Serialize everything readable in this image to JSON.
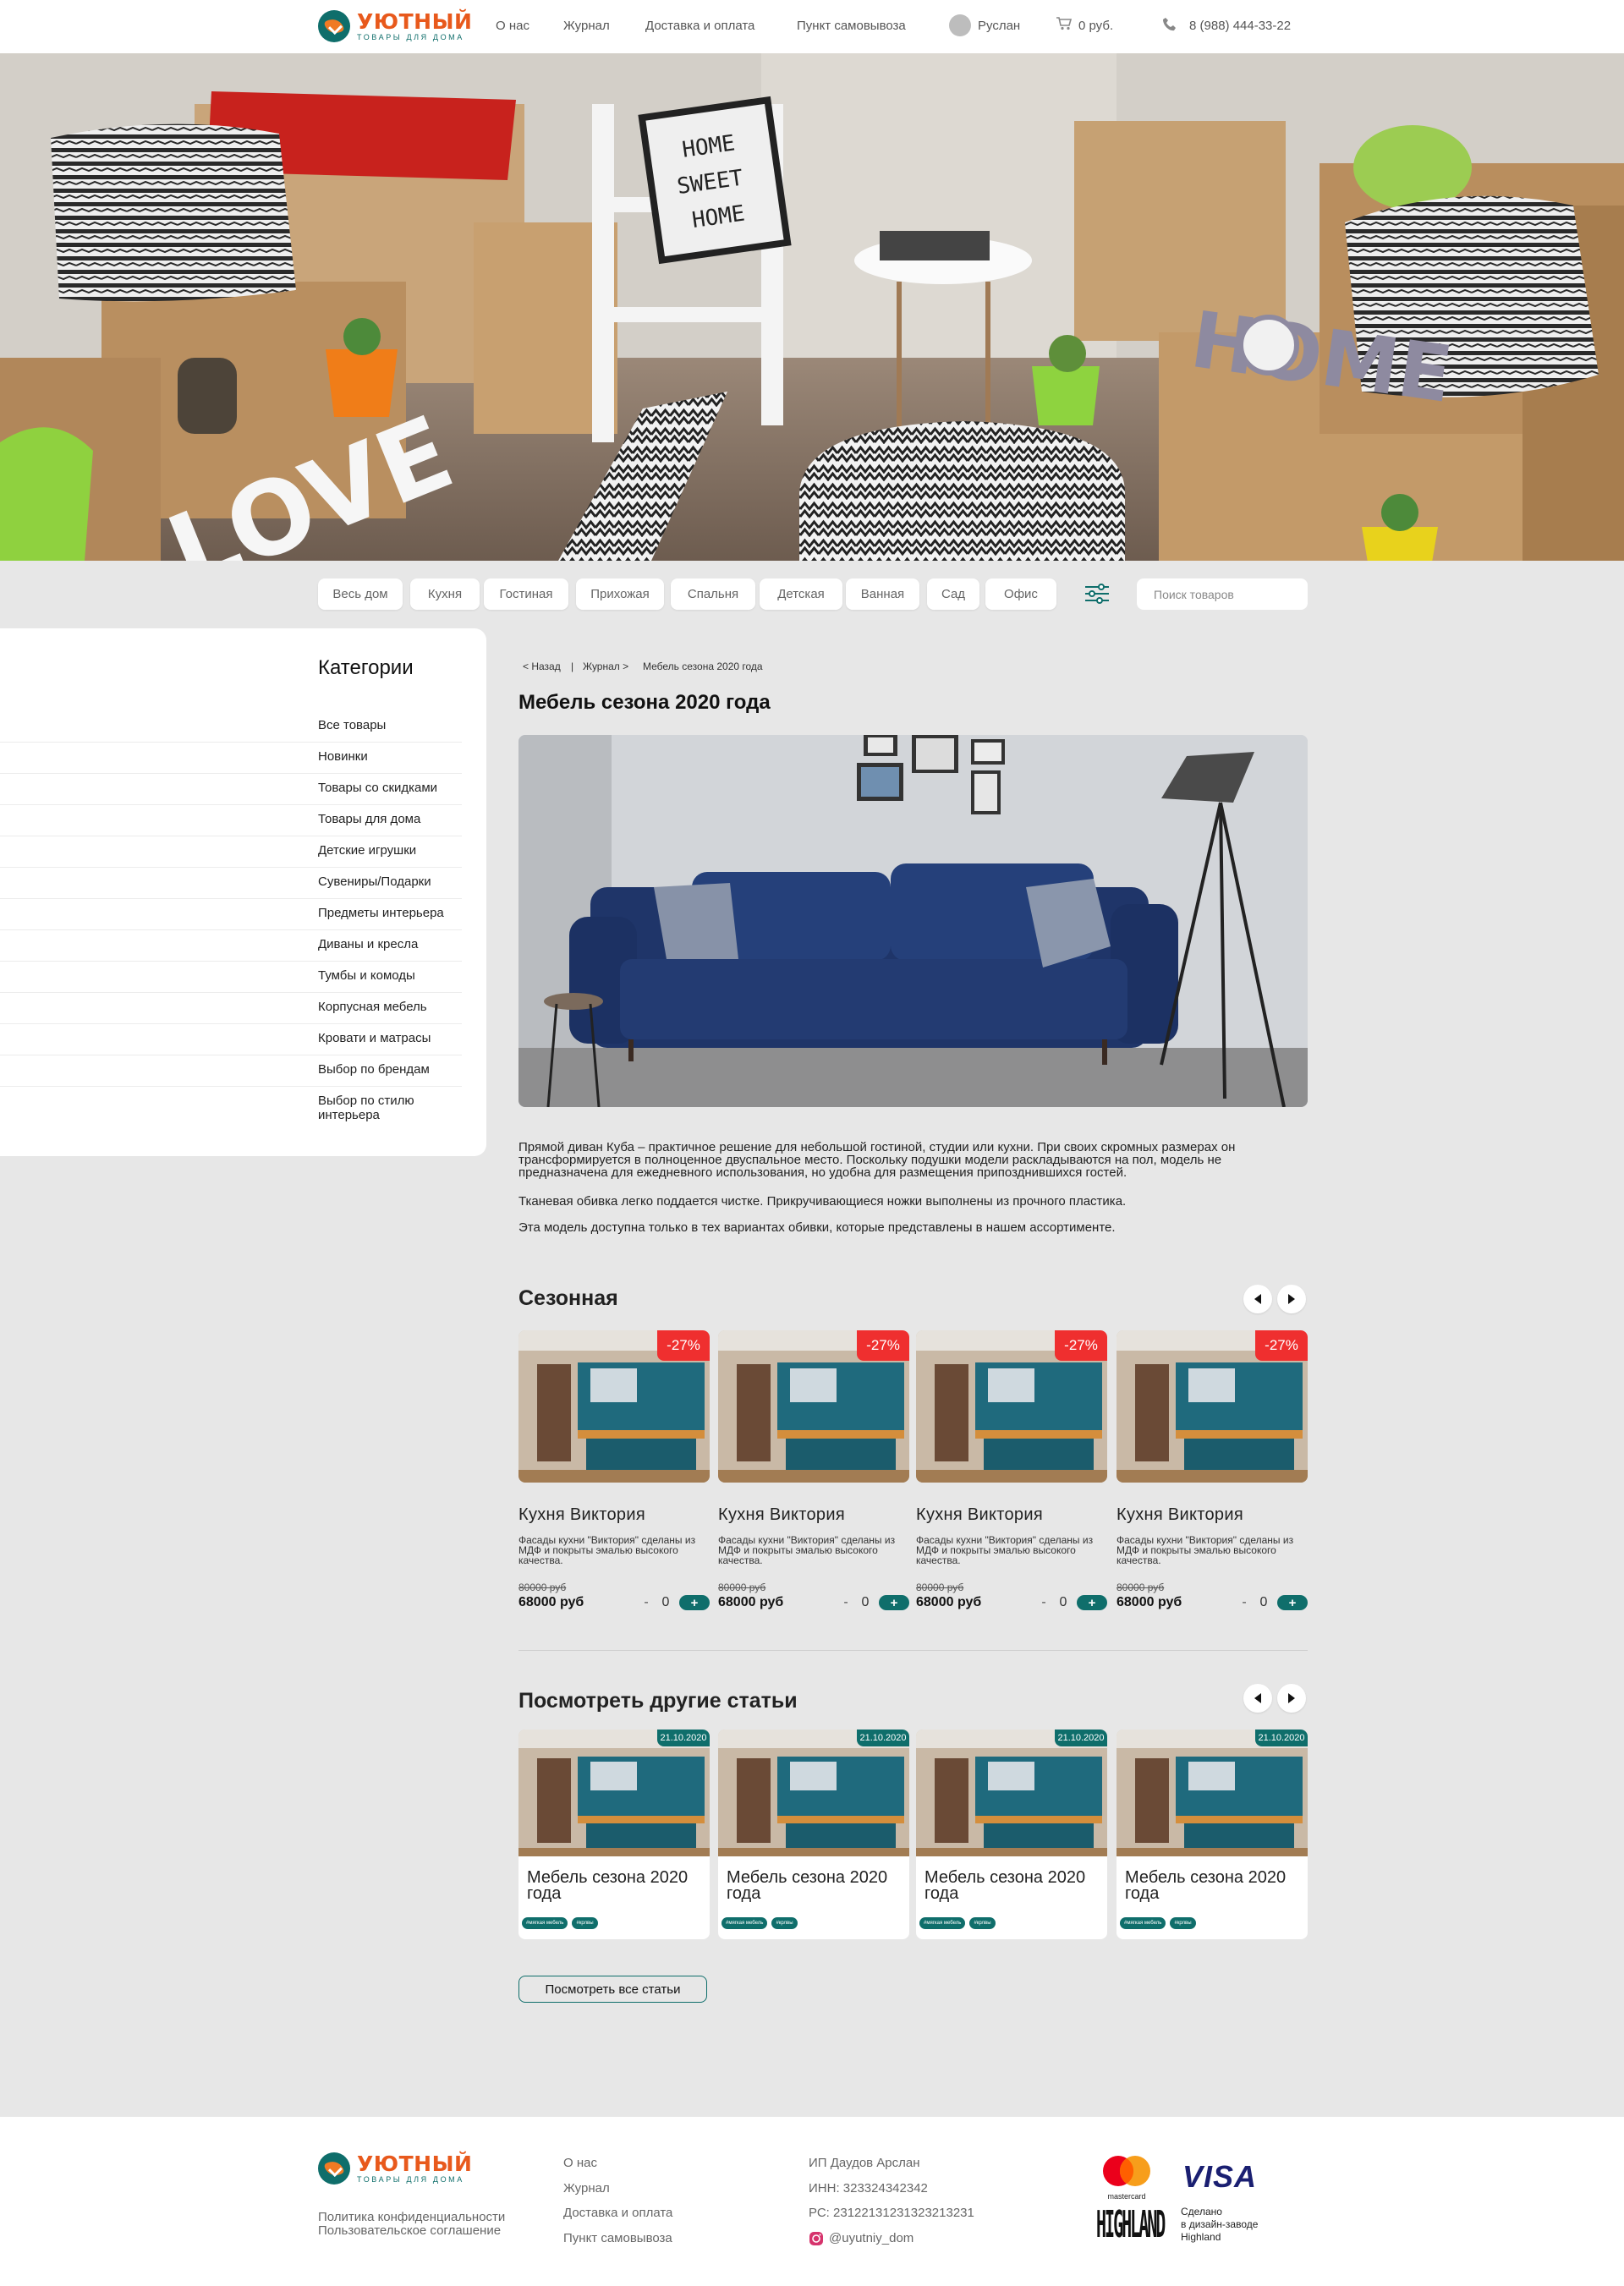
{
  "header": {
    "logo_name": "УЮТНЫЙ",
    "logo_sub": "ТОВАРЫ ДЛЯ ДОМА",
    "nav": [
      "О нас",
      "Журнал",
      "Доставка и оплата",
      "Пункт самовывоза"
    ],
    "user_name": "Руслан",
    "cart_total": "0 руб.",
    "phone": "8 (988) 444-33-22"
  },
  "hero": {
    "signboard": [
      "HOME",
      "SWEET",
      "HOME"
    ],
    "letters_home": "HOME",
    "letters_love": "LOVE"
  },
  "filters": {
    "chips": [
      "Весь дом",
      "Кухня",
      "Гостиная",
      "Прихожая",
      "Спальня",
      "Детская",
      "Ванная",
      "Сад",
      "Офис"
    ],
    "search_placeholder": "Поиск товаров"
  },
  "sidebar": {
    "title": "Категории",
    "items": [
      "Все товары",
      "Новинки",
      "Товары со скидками",
      "Товары для дома",
      "Детские игрушки",
      "Сувениры/Подарки",
      "Предметы интерьера",
      "Диваны и кресла",
      "Тумбы и комоды",
      "Корпусная мебель",
      "Кровати и матрасы",
      "Выбор по брендам",
      "Выбор по стилю интерьера"
    ]
  },
  "breadcrumb": {
    "back": "< Назад",
    "sep": "|",
    "journal": "Журнал >",
    "current": "Мебель сезона 2020 года"
  },
  "article": {
    "title": "Мебель сезона 2020 года",
    "paragraphs": [
      "Прямой диван Куба – практичное решение для небольшой гостиной, студии или кухни. При своих скромных размерах он трансформируется в полноценное двуспальное место. Поскольку подушки модели раскладываются на пол, модель не предназначена для ежедневного использования, но удобна для размещения припозднившихся гостей.",
      "Тканевая обивка легко поддается чистке. Прикручивающиеся ножки выполнены из прочного пластика.",
      "Эта модель доступна только в тех вариантах обивки, которые представлены в нашем ассортименте."
    ]
  },
  "seasonal": {
    "title": "Сезонная",
    "products": [
      {
        "badge": "-27%",
        "name": "Кухня Виктория",
        "desc": "Фасады кухни \"Виктория\" сделаны из МДФ и покрыты эмалью высокого качества.",
        "old_price": "80000 руб",
        "price": "68000 руб",
        "minus": "-",
        "qty": "0",
        "plus": "+"
      },
      {
        "badge": "-27%",
        "name": "Кухня Виктория",
        "desc": "Фасады кухни \"Виктория\" сделаны из МДФ и покрыты эмалью высокого качества.",
        "old_price": "80000 руб",
        "price": "68000 руб",
        "minus": "-",
        "qty": "0",
        "plus": "+"
      },
      {
        "badge": "-27%",
        "name": "Кухня Виктория",
        "desc": "Фасады кухни \"Виктория\" сделаны из МДФ и покрыты эмалью высокого качества.",
        "old_price": "80000 руб",
        "price": "68000 руб",
        "minus": "-",
        "qty": "0",
        "plus": "+"
      },
      {
        "badge": "-27%",
        "name": "Кухня Виктория",
        "desc": "Фасады кухни \"Виктория\" сделаны из МДФ и покрыты эмалью высокого качества.",
        "old_price": "80000 руб",
        "price": "68000 руб",
        "minus": "-",
        "qty": "0",
        "plus": "+"
      }
    ]
  },
  "other_articles": {
    "title": "Посмотреть другие статьи",
    "items": [
      {
        "date": "21.10.2020",
        "title": "Мебель сезона 2020 года",
        "tags": [
          "#мягкая мебель",
          "#крлвы"
        ]
      },
      {
        "date": "21.10.2020",
        "title": "Мебель сезона 2020 года",
        "tags": [
          "#мягкая мебель",
          "#крлвы"
        ]
      },
      {
        "date": "21.10.2020",
        "title": "Мебель сезона 2020 года",
        "tags": [
          "#мягкая мебель",
          "#крлвы"
        ]
      },
      {
        "date": "21.10.2020",
        "title": "Мебель сезона 2020 года",
        "tags": [
          "#мягкая мебель",
          "#крлвы"
        ]
      }
    ],
    "all_button": "Посмотреть все статьи"
  },
  "footer": {
    "policy": "Политика конфиденциальности",
    "agreement": "Пользовательское соглашение",
    "links": [
      "О нас",
      "Журнал",
      "Доставка и оплата",
      "Пункт самовывоза"
    ],
    "company": "ИП Даудов Арслан",
    "inn": "ИНН: 323324342342",
    "rs": "РС: 23122131231323213231",
    "instagram": "@uyutniy_dom",
    "mastercard": "mastercard",
    "visa": "VISA",
    "highland_logo": "HIGHLAND",
    "made_by": [
      "Сделано",
      "в дизайн-заводе",
      "Highland"
    ]
  },
  "colors": {
    "brand_teal": "#0f6e6b",
    "brand_orange": "#e8591c",
    "badge_red": "#ef2f2f",
    "page_bg": "#e7e7e7"
  },
  "icons": [
    "user-avatar-icon",
    "cart-icon",
    "phone-icon",
    "filter-sliders-icon",
    "arrow-left-icon",
    "arrow-right-icon",
    "instagram-icon"
  ]
}
